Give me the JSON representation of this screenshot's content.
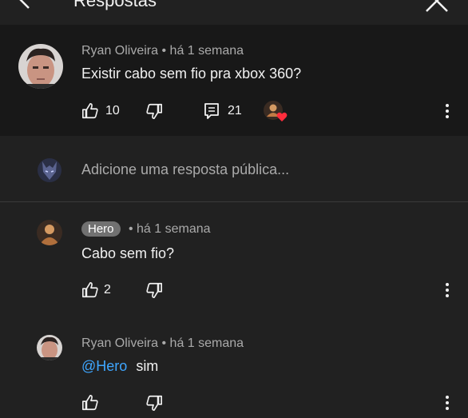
{
  "header": {
    "title": "Respostas"
  },
  "parent_comment": {
    "author": "Ryan Oliveira",
    "time": "há 1 semana",
    "text": "Existir cabo sem fio pra xbox 360?",
    "likes": "10",
    "replies": "21"
  },
  "reply_box": {
    "placeholder": "Adicione uma resposta pública..."
  },
  "replies": [
    {
      "author": "Hero",
      "time": "há 1 semana",
      "text": "Cabo sem fio?",
      "likes": "2"
    },
    {
      "author": "Ryan Oliveira",
      "time": "há 1 semana",
      "mention": "@Hero",
      "text": "sim"
    }
  ],
  "separator": "•",
  "colors": {
    "background": "#212121",
    "highlight": "#181818",
    "mention": "#3ea6ff",
    "heart": "#ff2d3c"
  }
}
